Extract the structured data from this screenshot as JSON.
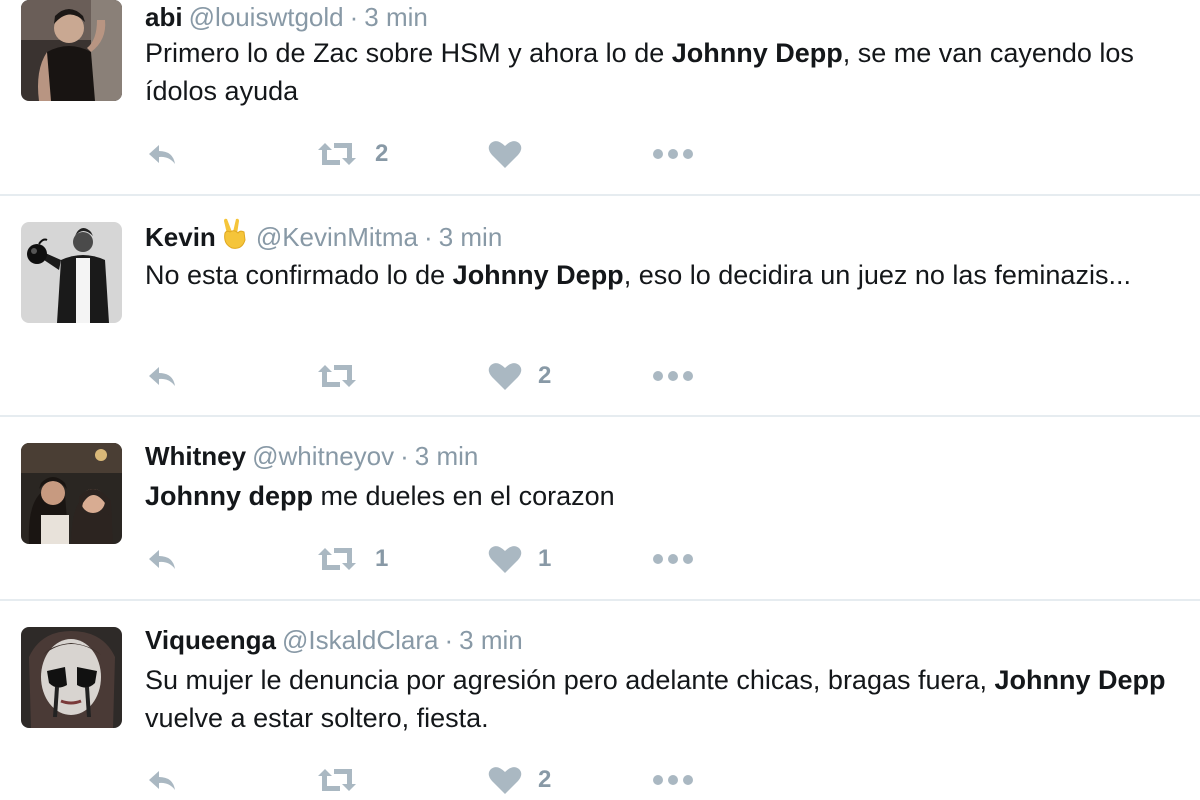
{
  "tweets": [
    {
      "name": "abi",
      "handle": "@louiswtgold",
      "separator": "·",
      "time": "3 min",
      "text_parts": [
        "Primero lo de Zac sobre HSM y ahora lo de ",
        "Johnny Depp",
        ", se me van cayendo los ídolos ayuda"
      ],
      "retweets": "2",
      "likes": ""
    },
    {
      "name": "Kevin",
      "emoji": "victory-hand-emoji",
      "handle": "@KevinMitma",
      "separator": "·",
      "time": "3 min",
      "text_parts": [
        "No esta confirmado lo de ",
        "Johnny Depp",
        ", eso lo decidira un juez no las feminazis..."
      ],
      "retweets": "",
      "likes": "2"
    },
    {
      "name": "Whitney",
      "handle": "@whitneyov",
      "separator": "·",
      "time": "3 min",
      "text_parts": [
        "",
        "Johnny depp",
        " me dueles en el corazon"
      ],
      "retweets": "1",
      "likes": "1"
    },
    {
      "name": "Viqueenga",
      "handle": "@IskaldClara",
      "separator": "·",
      "time": "3 min",
      "text_parts": [
        "Su mujer le denuncia por agresión pero adelante chicas, bragas fuera, ",
        "Johnny Depp",
        " vuelve a estar soltero, fiesta."
      ],
      "retweets": "",
      "likes": "2"
    }
  ],
  "icons": {
    "reply": "reply-icon",
    "retweet": "retweet-icon",
    "like": "heart-icon",
    "more": "more-icon"
  },
  "colors": {
    "text": "#14171a",
    "muted": "#8899a6",
    "icon": "#aab8c2",
    "divider": "#e6ecf0"
  }
}
